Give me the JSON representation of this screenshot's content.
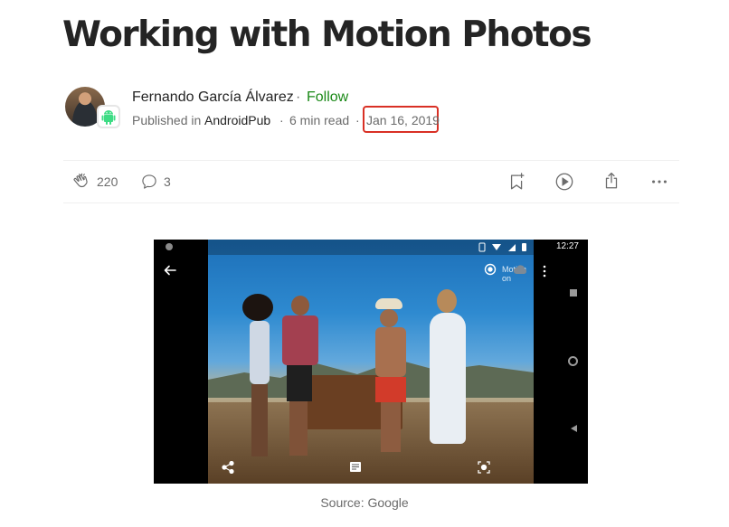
{
  "article": {
    "title": "Working with Motion Photos",
    "author": "Fernando García Álvarez",
    "separator": "·",
    "follow_label": "Follow",
    "published_in_label": "Published in",
    "publication": "AndroidPub",
    "read_time": "6 min read",
    "date": "Jan 16, 2019"
  },
  "actions": {
    "claps": "220",
    "responses": "3",
    "save_icon": "bookmark-plus-icon",
    "listen_icon": "play-circle-icon",
    "share_icon": "share-icon",
    "more_icon": "more-horizontal-icon"
  },
  "figure": {
    "status_time": "12:27",
    "motion_label": "Motion on",
    "caption": "Source: Google"
  },
  "colors": {
    "follow": "#1a8917",
    "highlight": "#d93025",
    "text": "#242424",
    "muted": "#6b6b6b"
  }
}
